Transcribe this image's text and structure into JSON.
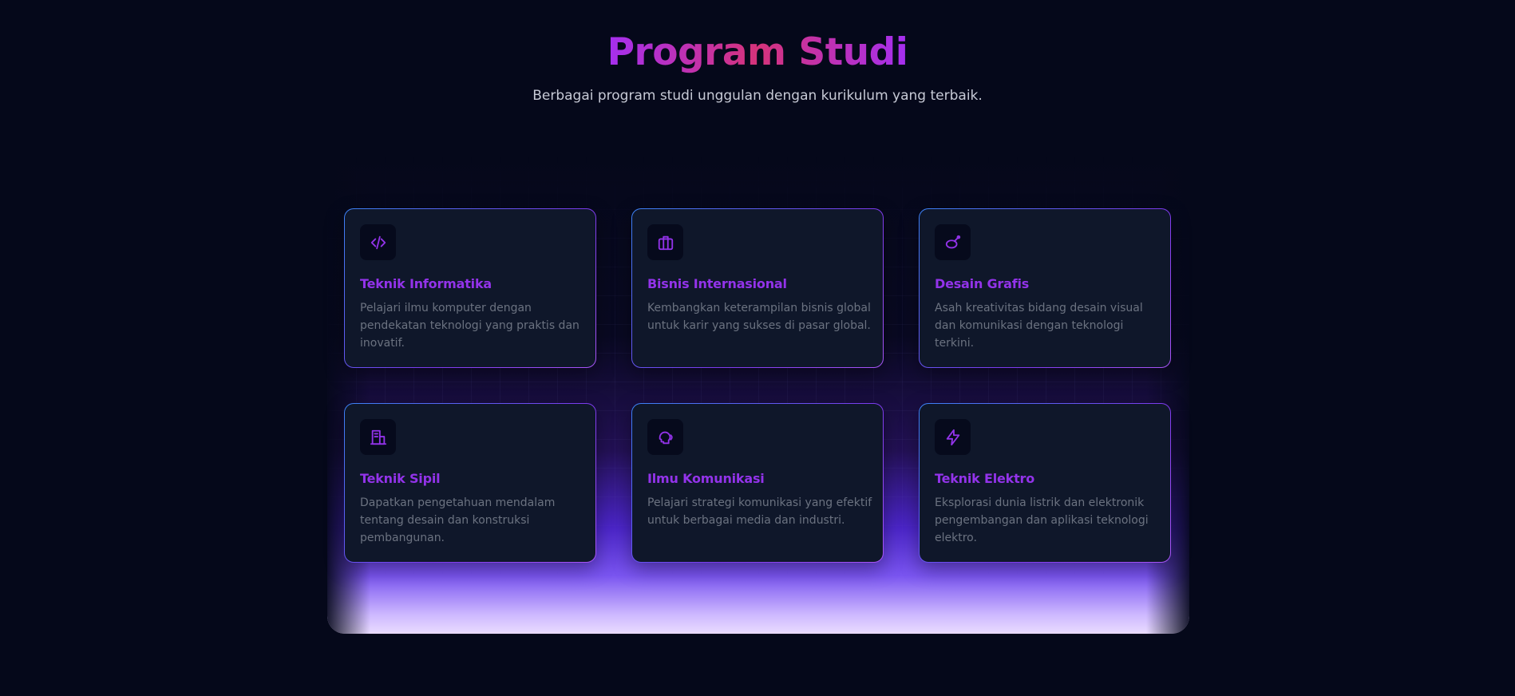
{
  "header": {
    "title": "Program Studi",
    "subtitle": "Berbagai program studi unggulan dengan kurikulum yang terbaik."
  },
  "colors": {
    "background": "#05081a",
    "card": "#0f172a",
    "accent_purple": "#9333ea",
    "title_gradient_start": "#a52ff0",
    "title_gradient_mid": "#d6337a",
    "glow": "#7a55f0"
  },
  "programs": [
    {
      "icon": "code-icon",
      "title": "Teknik Informatika",
      "description": "Pelajari ilmu komputer dengan pendekatan teknologi yang praktis dan inovatif."
    },
    {
      "icon": "briefcase-icon",
      "title": "Bisnis Internasional",
      "description": "Kembangkan keterampilan bisnis global untuk karir yang sukses di pasar global."
    },
    {
      "icon": "paint-brush-icon",
      "title": "Desain Grafis",
      "description": "Asah kreativitas bidang desain visual dan komunikasi dengan teknologi terkini."
    },
    {
      "icon": "building-icon",
      "title": "Teknik Sipil",
      "description": "Dapatkan pengetahuan mendalam tentang desain dan konstruksi pembangunan."
    },
    {
      "icon": "speaking-head-icon",
      "title": "Ilmu Komunikasi",
      "description": "Pelajari strategi komunikasi yang efektif untuk berbagai media dan industri."
    },
    {
      "icon": "lightning-bolt-icon",
      "title": "Teknik Elektro",
      "description": "Eksplorasi dunia listrik dan elektronik pengembangan dan aplikasi teknologi elektro."
    }
  ]
}
